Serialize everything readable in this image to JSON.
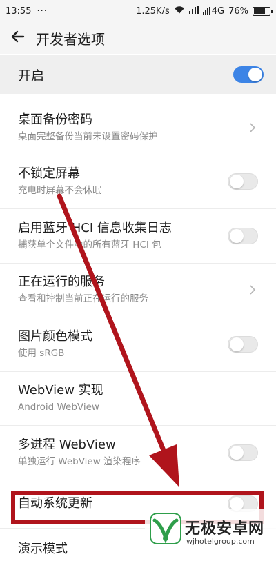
{
  "status_bar": {
    "time": "13:55",
    "dots": "···",
    "speed": "1.25K/s",
    "network": "4G",
    "battery_text": "76%",
    "battery_level": 0.76
  },
  "header": {
    "back_icon": "arrow-left-icon",
    "title": "开发者选项"
  },
  "master_switch": {
    "label": "开启",
    "on": true
  },
  "items": [
    {
      "title": "桌面备份密码",
      "subtitle": "桌面完整备份当前未设置密码保护",
      "control": "chevron"
    },
    {
      "title": "不锁定屏幕",
      "subtitle": "充电时屏幕不会休眠",
      "control": "toggle-off"
    },
    {
      "title": "启用蓝牙 HCI 信息收集日志",
      "subtitle": "捕获单个文件中的所有蓝牙 HCI 包",
      "control": "toggle-off"
    },
    {
      "title": "正在运行的服务",
      "subtitle": "查看和控制当前正在运行的服务",
      "control": "chevron"
    },
    {
      "title": "图片颜色模式",
      "subtitle": "使用 sRGB",
      "control": "toggle-off"
    },
    {
      "title": "WebView 实现",
      "subtitle": "Android WebView",
      "control": "none"
    },
    {
      "title": "多进程 WebView",
      "subtitle": "单独运行 WebView 渲染程序",
      "control": "toggle-off"
    },
    {
      "title": "自动系统更新",
      "subtitle": "",
      "control": "toggle-off"
    },
    {
      "title": "演示模式",
      "subtitle": "",
      "control": "none"
    }
  ],
  "annotation": {
    "arrow_color": "#b0141c",
    "highlight_color": "#b0141c"
  },
  "watermark": {
    "name": "无极安卓网",
    "url": "wjhotelgroup.com"
  },
  "colors": {
    "accent": "#3c84e6",
    "header_bg": "#f5f5f5",
    "master_bg": "#efefef"
  }
}
